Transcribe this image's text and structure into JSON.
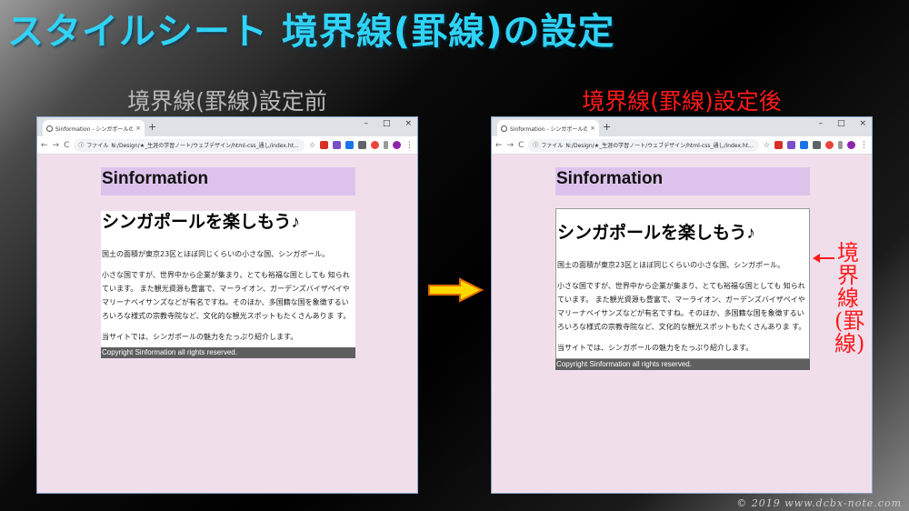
{
  "slide": {
    "title": "スタイルシート 境界線(罫線)の設定",
    "label_before": "境界線(罫線)設定前",
    "label_after": "境界線(罫線)設定後",
    "callout": "境界線(罫線)",
    "copyright": "© 2019 www.dcbx-note.com"
  },
  "browser": {
    "tab_title": "Sinformation - シンガポールの観光",
    "tab_close": "×",
    "new_tab": "+",
    "minimize": "–",
    "maximize": "□",
    "close": "×",
    "back": "←",
    "forward": "→",
    "reload": "C",
    "info": "ⓘ",
    "address_scheme": "ファイル",
    "address_url": "N:/Design/★_生涯の学習ノート/ウェブデザイン/html-css_通し/index.ht...",
    "bookmark": "☆",
    "menu": "⋮"
  },
  "page": {
    "header": "Sinformation",
    "main_heading": "シンガポールを楽しもう♪",
    "paragraphs": [
      "国土の面積が東京23区とほぼ同じくらいの小さな国、シンガポール。",
      "小さな国ですが、世界中から企業が集まり、とても裕福な国としても 知られています。 また観光資源も豊富で、マーライオン、ガーデンズバイザベイやマリーナベイサンズなどが有名ですね。そのほか、多国籍な国を象徴するい ろいろな様式の宗教寺院など、文化的な観光スポットもたくさんありま す。",
      "当サイトでは、シンガポールの魅力をたっぷり紹介します。"
    ],
    "footer": "Copyright Sinformation all rights reserved."
  },
  "colors": {
    "title": "#2fd3f5",
    "label_before": "#b8b8b8",
    "label_after": "#ff1a1a",
    "page_bg": "#f0dfeb",
    "header_bg": "#ddc3ec",
    "footer_bg": "#5f5f5f",
    "arrow": "#ffd800"
  }
}
